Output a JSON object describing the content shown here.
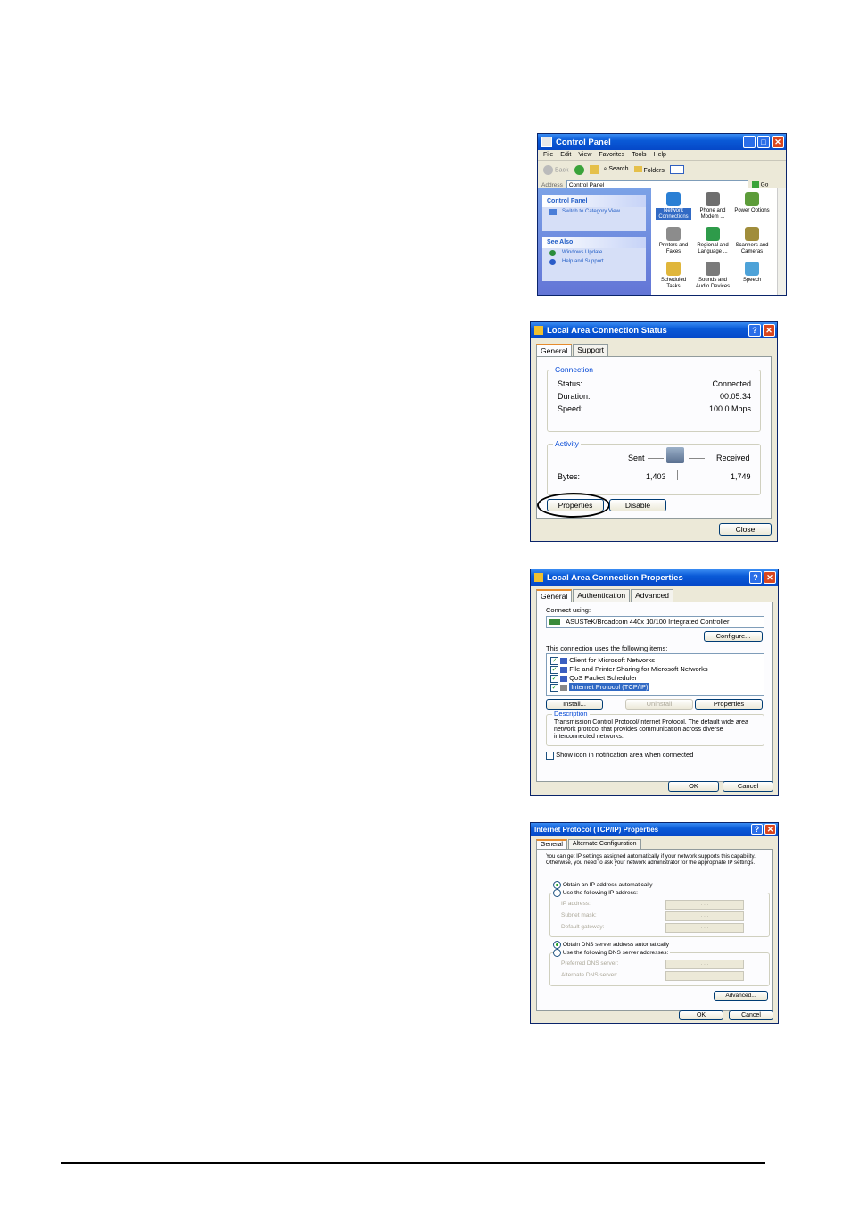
{
  "control_panel": {
    "title": "Control Panel",
    "menu": [
      "File",
      "Edit",
      "View",
      "Favorites",
      "Tools",
      "Help"
    ],
    "toolbar": {
      "back": "Back",
      "search": "Search",
      "folders": "Folders"
    },
    "address_label": "Address",
    "address_value": "Control Panel",
    "go_label": "Go",
    "sidebar": {
      "panel_title": "Control Panel",
      "switch_link": "Switch to Category View",
      "see_also_title": "See Also",
      "links": [
        "Windows Update",
        "Help and Support"
      ]
    },
    "items": [
      {
        "line1": "Network",
        "line2": "Connections",
        "color": "#2a7fd4",
        "selected": true
      },
      {
        "line1": "Phone and",
        "line2": "Modem ...",
        "color": "#6e6e6e"
      },
      {
        "line1": "Power Options",
        "line2": "",
        "color": "#5d9c3a"
      },
      {
        "line1": "Printers and",
        "line2": "Faxes",
        "color": "#8c8c8c"
      },
      {
        "line1": "Regional and",
        "line2": "Language ...",
        "color": "#2e9b4a"
      },
      {
        "line1": "Scanners and",
        "line2": "Cameras",
        "color": "#a08d3b"
      },
      {
        "line1": "Scheduled",
        "line2": "Tasks",
        "color": "#e0b63b"
      },
      {
        "line1": "Sounds and",
        "line2": "Audio Devices",
        "color": "#7a7a7a"
      },
      {
        "line1": "Speech",
        "line2": "",
        "color": "#4da2d8"
      }
    ]
  },
  "status_dialog": {
    "title": "Local Area Connection Status",
    "tabs": [
      "General",
      "Support"
    ],
    "connection_group": "Connection",
    "status_label": "Status:",
    "status_value": "Connected",
    "duration_label": "Duration:",
    "duration_value": "00:05:34",
    "speed_label": "Speed:",
    "speed_value": "100.0 Mbps",
    "activity_group": "Activity",
    "sent_label": "Sent",
    "received_label": "Received",
    "bytes_label": "Bytes:",
    "bytes_sent": "1,403",
    "bytes_received": "1,749",
    "properties_button": "Properties",
    "disable_button": "Disable",
    "close_button": "Close"
  },
  "properties_dialog": {
    "title": "Local Area Connection Properties",
    "tabs": [
      "General",
      "Authentication",
      "Advanced"
    ],
    "connect_using_label": "Connect using:",
    "adapter": "ASUSTeK/Broadcom 440x 10/100 Integrated Controller",
    "configure_button": "Configure...",
    "items_label": "This connection uses the following items:",
    "items": [
      "Client for Microsoft Networks",
      "File and Printer Sharing for Microsoft Networks",
      "QoS Packet Scheduler",
      "Internet Protocol (TCP/IP)"
    ],
    "install_button": "Install...",
    "uninstall_button": "Uninstall",
    "properties_button": "Properties",
    "description_group": "Description",
    "description_text": "Transmission Control Protocol/Internet Protocol. The default wide area network protocol that provides communication across diverse interconnected networks.",
    "show_icon_label": "Show icon in notification area when connected",
    "ok_button": "OK",
    "cancel_button": "Cancel"
  },
  "tcpip_dialog": {
    "title": "Internet Protocol (TCP/IP) Properties",
    "tabs": [
      "General",
      "Alternate Configuration"
    ],
    "intro": "You can get IP settings assigned automatically if your network supports this capability. Otherwise, you need to ask your network administrator for the appropriate IP settings.",
    "obtain_ip_auto": "Obtain an IP address automatically",
    "use_following_ip": "Use the following IP address:",
    "ip_address_label": "IP address:",
    "subnet_label": "Subnet mask:",
    "gateway_label": "Default gateway:",
    "obtain_dns_auto": "Obtain DNS server address automatically",
    "use_following_dns": "Use the following DNS server addresses:",
    "preferred_dns_label": "Preferred DNS server:",
    "alternate_dns_label": "Alternate DNS server:",
    "ip_placeholder": ". . .",
    "advanced_button": "Advanced...",
    "ok_button": "OK",
    "cancel_button": "Cancel"
  }
}
